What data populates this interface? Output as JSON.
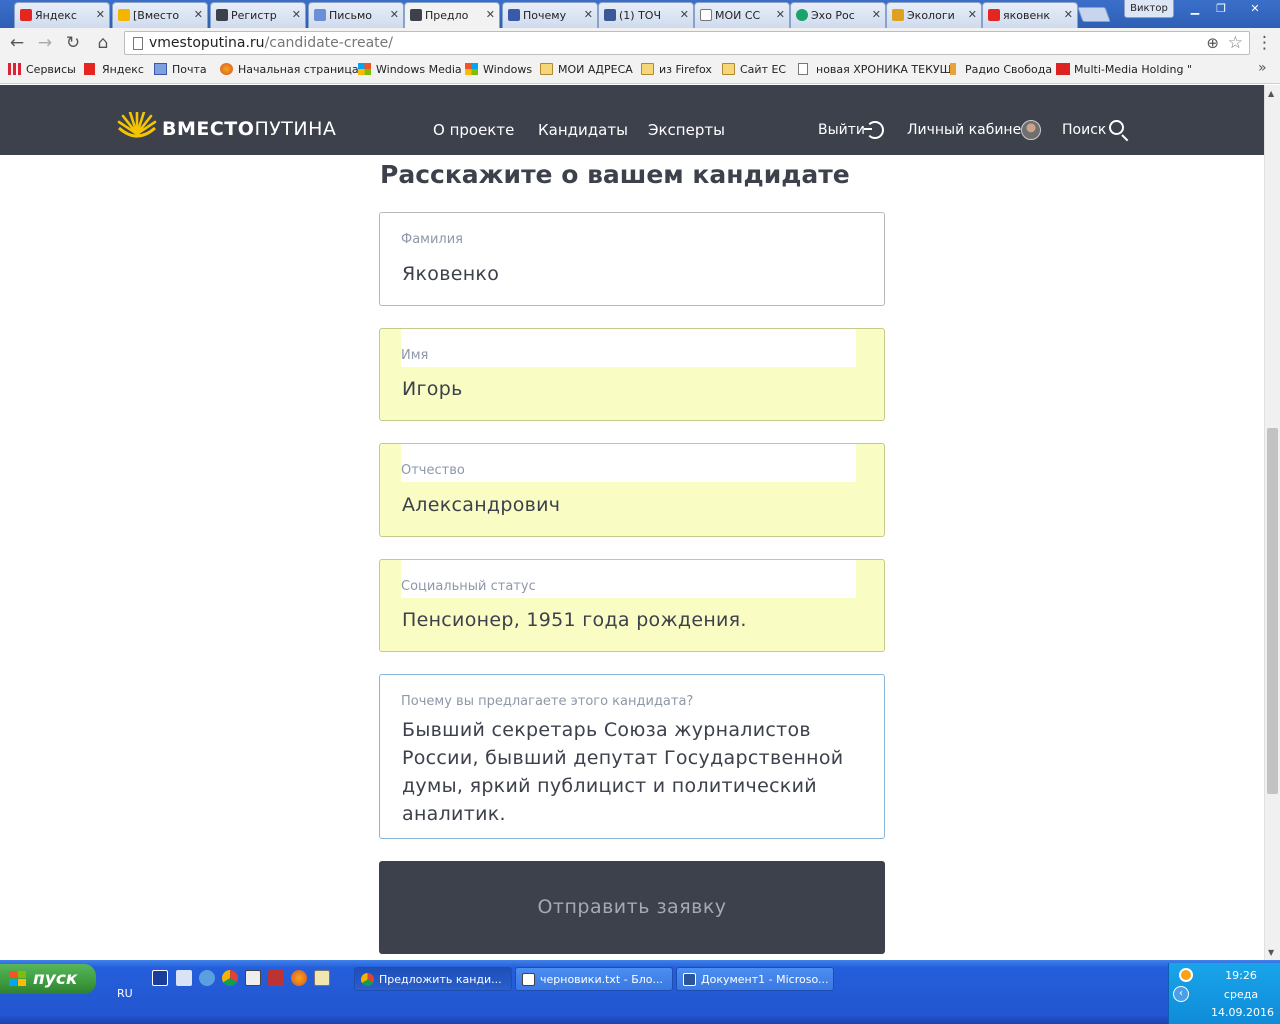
{
  "browser": {
    "tabs": [
      {
        "label": "Яндекс",
        "color": "#e52620"
      },
      {
        "label": "[Вместо",
        "color": "#f5b400"
      },
      {
        "label": "Регистр",
        "color": "#3c414c"
      },
      {
        "label": "Письмо",
        "color": "#6b8fd6"
      },
      {
        "label": "Предло",
        "color": "#3c414c"
      },
      {
        "label": "Почему",
        "color": "#3a5aa8"
      },
      {
        "label": "(1) ТОЧ",
        "color": "#3b5998"
      },
      {
        "label": "МОИ СС",
        "color": "#ffffff"
      },
      {
        "label": "Эхо Рос",
        "color": "#1aa36b"
      },
      {
        "label": "Экологи",
        "color": "#e0a020"
      },
      {
        "label": "яковенк",
        "color": "#e52620"
      }
    ],
    "profile_name": "Виктор",
    "url_host": "vmestoputina.ru",
    "url_path": "/candidate-create/",
    "bookmarks": [
      {
        "label": "Сервисы",
        "icon": "apps-icon"
      },
      {
        "label": "Яндекс",
        "icon": "yandex-icon"
      },
      {
        "label": "Почта",
        "icon": "mail-icon"
      },
      {
        "label": "Начальная страница",
        "icon": "firefox-icon"
      },
      {
        "label": "Windows Media",
        "icon": "windows-icon"
      },
      {
        "label": "Windows",
        "icon": "windows-icon"
      },
      {
        "label": "МОИ АДРЕСА",
        "icon": "folder-icon"
      },
      {
        "label": "из Firefox",
        "icon": "folder-icon"
      },
      {
        "label": "Сайт ЕС",
        "icon": "folder-icon"
      },
      {
        "label": "новая ХРОНИКА ТЕКУЩ",
        "icon": "page-icon"
      },
      {
        "label": "Радио Свобода",
        "icon": "radio-icon"
      },
      {
        "label": "Multi-Media Holding \"NAS",
        "icon": "nd-icon"
      }
    ]
  },
  "site": {
    "logo_bold": "ВМЕСТО",
    "logo_light": "ПУТИНА",
    "nav": [
      "О проекте",
      "Кандидаты",
      "Эксперты"
    ],
    "logout_label": "Выйти",
    "cabinet_label": "Личный кабинет",
    "search_label": "Поиск"
  },
  "form": {
    "title": "Расскажите о вашем кандидате",
    "fields": [
      {
        "label": "Фамилия",
        "value": "Яковенко"
      },
      {
        "label": "Имя",
        "value": "Игорь"
      },
      {
        "label": "Отчество",
        "value": "Александрович"
      },
      {
        "label": "Социальный статус",
        "value": "Пенсионер, 1951 года рождения."
      },
      {
        "label": "Почему вы предлагаете этого кандидата?",
        "value": "Бывший секретарь Союза журналистов России, бывший депутат Государственной думы, яркий публицист и политический аналитик."
      }
    ],
    "submit_label": "Отправить заявку"
  },
  "taskbar": {
    "start_label": "пуск",
    "language": "RU",
    "tasks": [
      {
        "label": "Предложить канди...",
        "icon": "chrome-icon"
      },
      {
        "label": "черновики.txt - Бло...",
        "icon": "notepad-icon"
      },
      {
        "label": "Документ1 - Microso...",
        "icon": "word-icon"
      }
    ],
    "time": "19:26",
    "day": "среда",
    "date": "14.09.2016"
  }
}
